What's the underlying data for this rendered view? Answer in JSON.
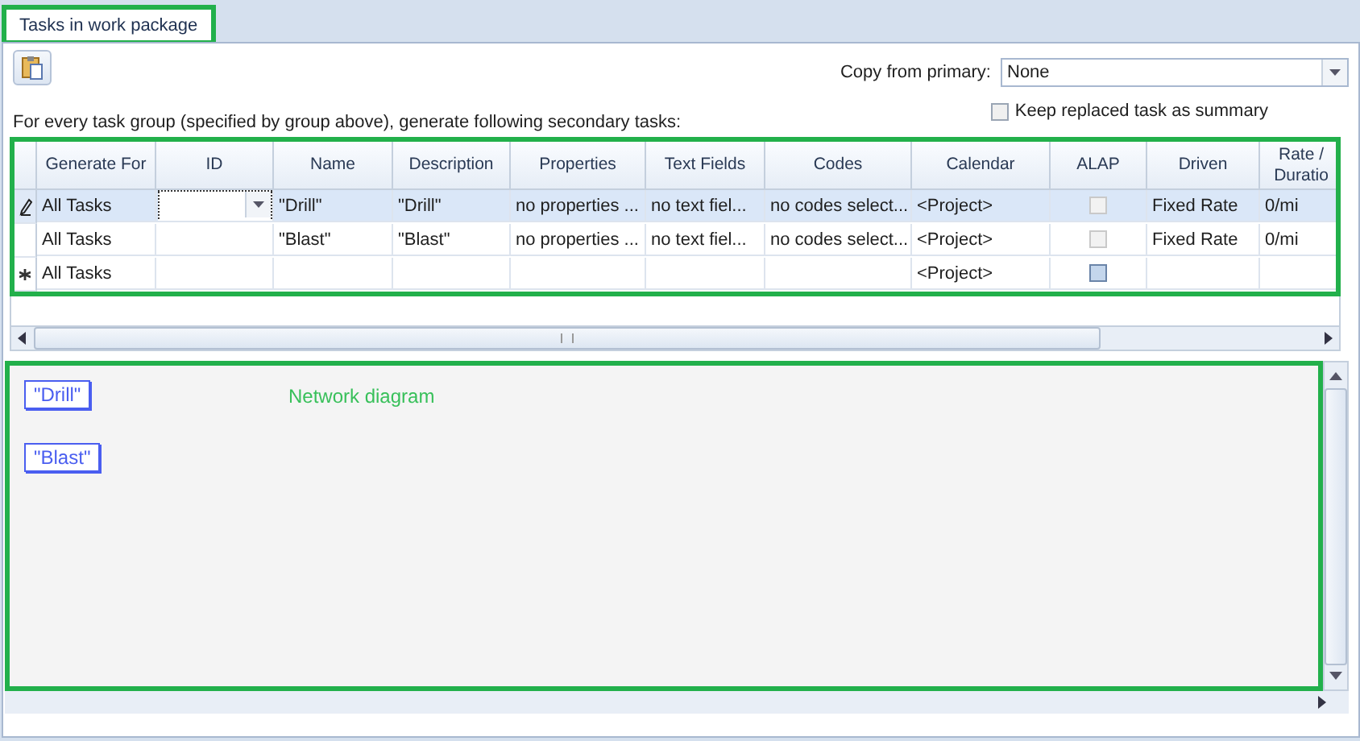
{
  "tabs": [
    {
      "label": "Tasks in work package",
      "selected": true
    }
  ],
  "copy_from_primary": {
    "label": "Copy from primary:",
    "value": "None"
  },
  "keep_replaced": {
    "label": "Keep replaced task as summary",
    "checked": false
  },
  "instruction": "For every task group (specified by group above), generate following secondary tasks:",
  "table": {
    "columns": [
      "Generate For",
      "ID",
      "Name",
      "Description",
      "Properties",
      "Text Fields",
      "Codes",
      "Calendar",
      "ALAP",
      "Driven",
      "Rate / Duratio"
    ],
    "rows": [
      {
        "kind": "editing",
        "selected": true,
        "id_editor": true,
        "generate_for": "All Tasks",
        "name": "\"Drill\"",
        "description": "\"Drill\"",
        "properties": "no properties ...",
        "text_fields": "no text fiel...",
        "codes": "no codes select...",
        "calendar": "<Project>",
        "alap": {
          "checked": false,
          "disabled": true
        },
        "driven": "Fixed Rate",
        "rate": "0/mi"
      },
      {
        "kind": "plain",
        "selected": false,
        "id_editor": false,
        "generate_for": "All Tasks",
        "name": "\"Blast\"",
        "description": "\"Blast\"",
        "properties": "no properties ...",
        "text_fields": "no text fiel...",
        "codes": "no codes select...",
        "calendar": "<Project>",
        "alap": {
          "checked": false,
          "disabled": true
        },
        "driven": "Fixed Rate",
        "rate": "0/mi"
      },
      {
        "kind": "new",
        "selected": false,
        "id_editor": false,
        "generate_for": "All Tasks",
        "calendar": "<Project>",
        "alap": {
          "checked": false,
          "disabled": false
        }
      }
    ]
  },
  "diagram": {
    "label": "Network diagram",
    "nodes": [
      "\"Drill\"",
      "\"Blast\""
    ]
  }
}
